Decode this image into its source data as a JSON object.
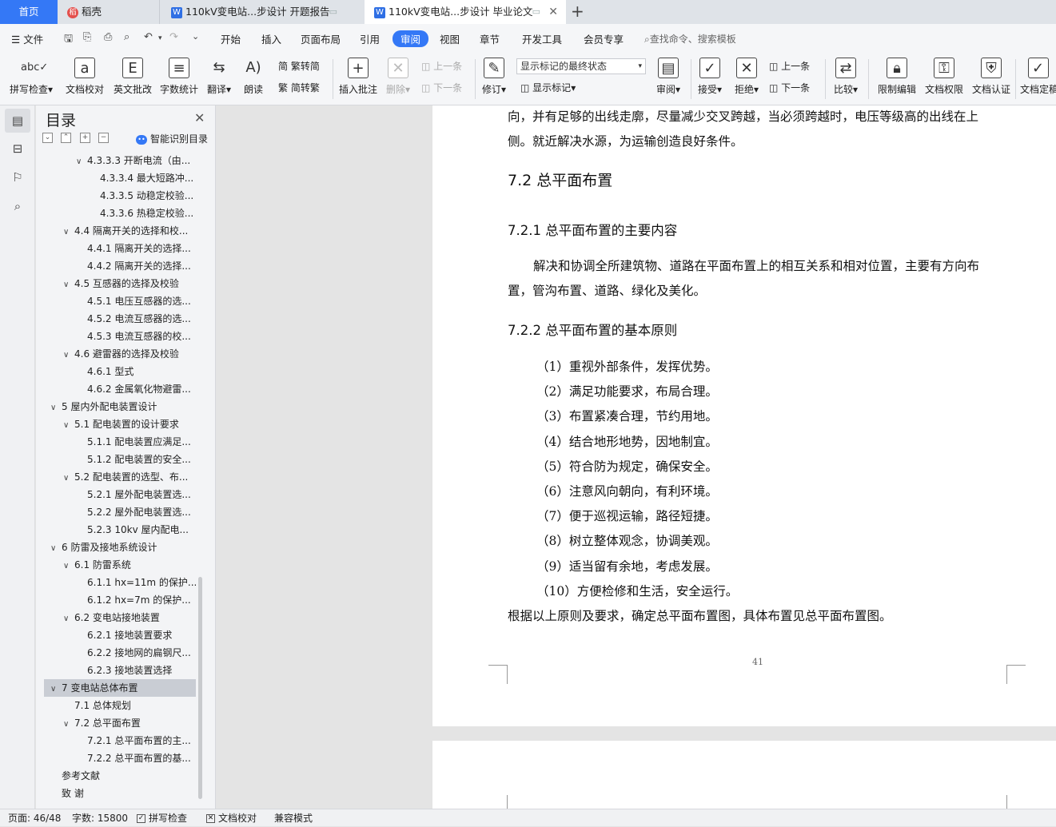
{
  "tabs": {
    "home": "首页",
    "daoke": "稻壳",
    "doc1": "110kV变电站...步设计 开题报告",
    "doc2": "110kV变电站...步设计 毕业论文",
    "new_tab": "+"
  },
  "menu": {
    "file": "文件",
    "items": [
      "开始",
      "插入",
      "页面布局",
      "引用",
      "审阅",
      "视图",
      "章节",
      "开发工具",
      "会员专享"
    ],
    "active": "审阅",
    "search_placeholder": "查找命令、搜索模板"
  },
  "ribbon": {
    "spell_check": "拼写检查",
    "doc_proofread": "文档校对",
    "english_review": "英文批改",
    "word_count": "字数统计",
    "translate": "翻译",
    "read_aloud": "朗读",
    "trad_simp": "繁转简",
    "simp_trad": "简转繁",
    "insert_comment": "插入批注",
    "delete": "删除",
    "prev_comment": "上一条",
    "next_comment": "下一条",
    "track_changes": "修订",
    "markup_dropdown": "显示标记的最终状态",
    "show_markup": "显示标记",
    "review": "审阅",
    "accept": "接受",
    "reject": "拒绝",
    "prev_change": "上一条",
    "next_change": "下一条",
    "compare": "比较",
    "restrict_edit": "限制编辑",
    "doc_permission": "文档权限",
    "doc_certify": "文档认证",
    "doc_finalize": "文档定稿"
  },
  "toc": {
    "title": "目录",
    "ai_label": "智能识别目录",
    "items": [
      {
        "label": "4.3.3.3  开断电流（由...",
        "arrow": "∨"
      },
      {
        "label": "4.3.3.4  最大短路冲...",
        "arrow": ""
      },
      {
        "label": "4.3.3.5  动稳定校验...",
        "arrow": ""
      },
      {
        "label": "4.3.3.6  热稳定校验...",
        "arrow": ""
      },
      {
        "label": "4.4  隔离开关的选择和校...",
        "arrow": "∨"
      },
      {
        "label": "4.4.1  隔离开关的选择...",
        "arrow": ""
      },
      {
        "label": "4.4.2  隔离开关的选择...",
        "arrow": ""
      },
      {
        "label": "4.5  互感器的选择及校验",
        "arrow": "∨"
      },
      {
        "label": "4.5.1  电压互感器的选...",
        "arrow": ""
      },
      {
        "label": "4.5.2  电流互感器的选...",
        "arrow": ""
      },
      {
        "label": "4.5.3  电流互感器的校...",
        "arrow": ""
      },
      {
        "label": "4.6  避雷器的选择及校验",
        "arrow": "∨"
      },
      {
        "label": "4.6.1  型式",
        "arrow": ""
      },
      {
        "label": "4.6.2  金属氧化物避雷...",
        "arrow": ""
      },
      {
        "label": "5  屋内外配电装置设计",
        "arrow": "∨"
      },
      {
        "label": "5.1  配电装置的设计要求",
        "arrow": "∨"
      },
      {
        "label": "5.1.1  配电装置应满足...",
        "arrow": ""
      },
      {
        "label": "5.1.2  配电装置的安全...",
        "arrow": ""
      },
      {
        "label": "5.2  配电装置的选型、布...",
        "arrow": "∨"
      },
      {
        "label": "5.2.1  屋外配电装置选...",
        "arrow": ""
      },
      {
        "label": "5.2.2  屋外配电装置选...",
        "arrow": ""
      },
      {
        "label": "5.2.3 10kv 屋内配电...",
        "arrow": ""
      },
      {
        "label": "6  防雷及接地系统设计",
        "arrow": "∨"
      },
      {
        "label": "6.1  防雷系统",
        "arrow": "∨"
      },
      {
        "label": "6.1.1 hx=11m 的保护...",
        "arrow": ""
      },
      {
        "label": "6.1.2 hx=7m 的保护...",
        "arrow": ""
      },
      {
        "label": "6.2  变电站接地装置",
        "arrow": "∨"
      },
      {
        "label": "6.2.1  接地装置要求",
        "arrow": ""
      },
      {
        "label": "6.2.2  接地网的扁钢尺...",
        "arrow": ""
      },
      {
        "label": "6.2.3  接地装置选择",
        "arrow": ""
      },
      {
        "label": "7  变电站总体布置",
        "arrow": "∨"
      },
      {
        "label": "7.1  总体规划",
        "arrow": ""
      },
      {
        "label": "7.2  总平面布置",
        "arrow": "∨"
      },
      {
        "label": "7.2.1  总平面布置的主...",
        "arrow": ""
      },
      {
        "label": "7.2.2  总平面布置的基...",
        "arrow": ""
      },
      {
        "label": "参考文献",
        "arrow": ""
      },
      {
        "label": "致    谢",
        "arrow": ""
      }
    ]
  },
  "document": {
    "intro_line1": "向，并有足够的出线走廓，尽量减少交叉跨越，当必须跨越时，电压等级高的出线在上",
    "intro_line2": "侧。就近解决水源，为运输创造良好条件。",
    "heading_72": "7.2  总平面布置",
    "heading_721": "7.2.1  总平面布置的主要内容",
    "para_721_line1": "解决和协调全所建筑物、道路在平面布置上的相互关系和相对位置，主要有方向布",
    "para_721_line2": "置，管沟布置、道路、绿化及美化。",
    "heading_722": "7.2.2  总平面布置的基本原则",
    "principles": [
      "（1）重视外部条件，发挥优势。",
      "（2）满足功能要求，布局合理。",
      "（3）布置紧凑合理，节约用地。",
      "（4）结合地形地势，因地制宜。",
      "（5）符合防为规定，确保安全。",
      "（6）注意风向朝向，有利环境。",
      "（7）便于巡视运输，路径短捷。",
      "（8）树立整体观念，协调美观。",
      "（9）适当留有余地，考虑发展。",
      "（10）方便检修和生活，安全运行。"
    ],
    "conclusion": "根据以上原则及要求，确定总平面布置图，具体布置见总平面布置图。",
    "page_number": "41"
  },
  "status": {
    "page": "页面: 46/48",
    "words": "字数: 15800",
    "spell_check": "拼写检查",
    "doc_proofread": "文档校对",
    "compat_mode": "兼容模式"
  }
}
